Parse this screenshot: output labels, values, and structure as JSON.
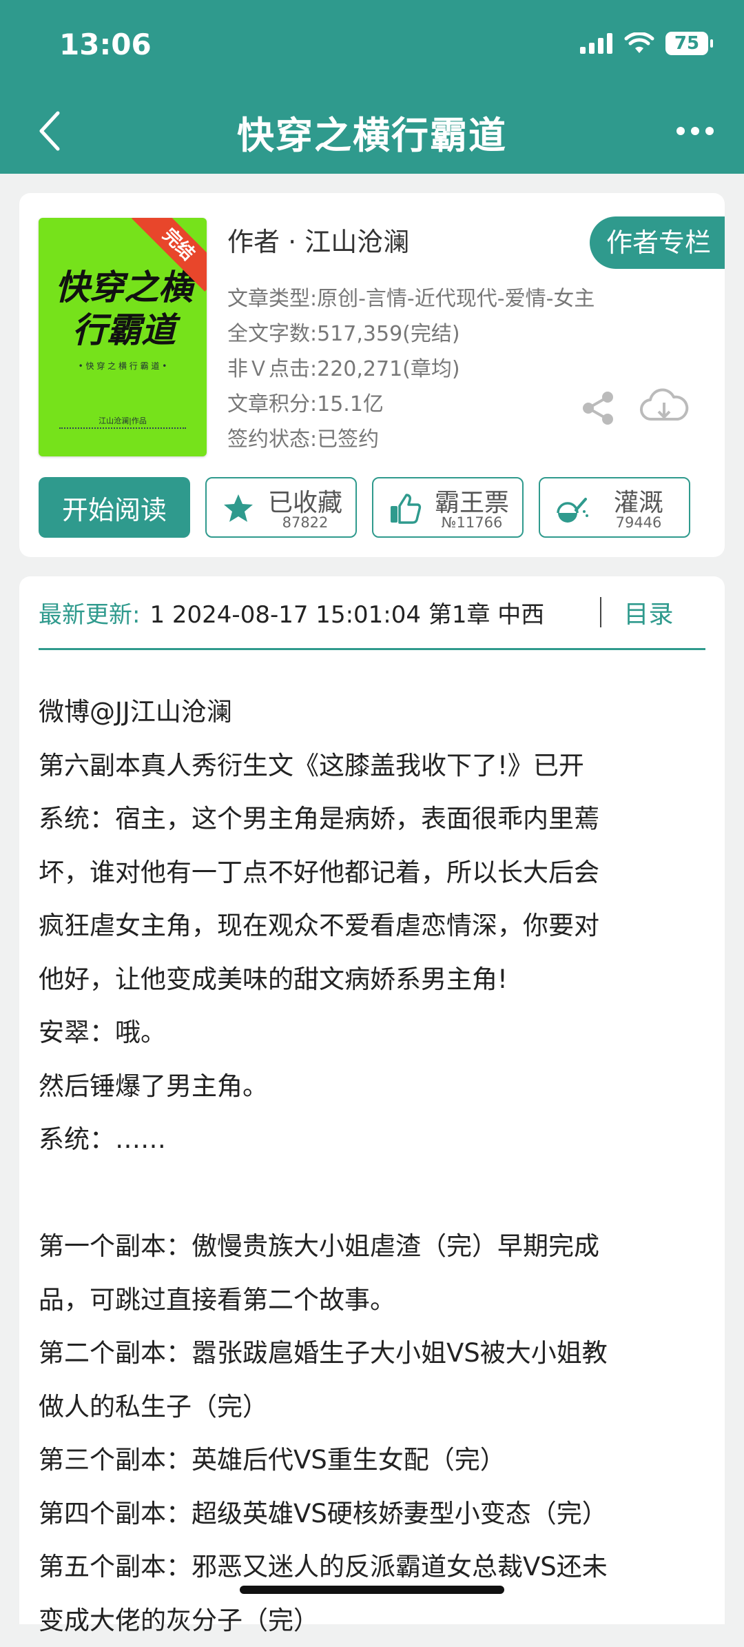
{
  "status_bar": {
    "time": "13:06",
    "battery": "75"
  },
  "header": {
    "title": "快穿之横行霸道"
  },
  "book": {
    "cover": {
      "title": "快穿之横行霸道",
      "badge": "完结",
      "subtitle": "• 快 穿 之 横 行 霸 道 •",
      "author_note": "江山沧澜|作品"
    },
    "author": "作者 · 江山沧澜",
    "author_column_label": "作者专栏",
    "meta": [
      "文章类型:原创-言情-近代现代-爱情-女主",
      "全文字数:517,359(完结)",
      "非Ｖ点击:220,271(章均)",
      "文章积分:15.1亿",
      "签约状态:已签约"
    ],
    "actions": {
      "start_read": "开始阅读",
      "favorite": {
        "label": "已收藏",
        "count": "87822"
      },
      "vote": {
        "label": "霸王票",
        "count": "№11766"
      },
      "water": {
        "label": "灌溉",
        "count": "79446"
      }
    }
  },
  "intro": {
    "update_label": "最新更新:",
    "update_text": "1 2024-08-17 15:01:04   第1章 中西",
    "toc_label": "目录",
    "lines": [
      "微博@JJ江山沧澜",
      "第六副本真人秀衍生文《这膝盖我收下了!》已开",
      "系统：宿主，这个男主角是病娇，表面很乖内里蔫",
      "坏，谁对他有一丁点不好他都记着，所以长大后会",
      "疯狂虐女主角，现在观众不爱看虐恋情深，你要对",
      "他好，让他变成美味的甜文病娇系男主角!",
      "安翠：哦。",
      "然后锤爆了男主角。",
      "系统：……",
      "",
      "第一个副本：傲慢贵族大小姐虐渣（完）早期完成",
      "品，可跳过直接看第二个故事。",
      "第二个副本：嚣张跋扈婚生子大小姐VS被大小姐教",
      "做人的私生子（完）",
      "第三个副本：英雄后代VS重生女配（完）",
      "第四个副本：超级英雄VS硬核娇妻型小变态（完）",
      "第五个副本：邪恶又迷人的反派霸道女总裁VS还未",
      "变成大佬的灰分子（完）"
    ]
  }
}
